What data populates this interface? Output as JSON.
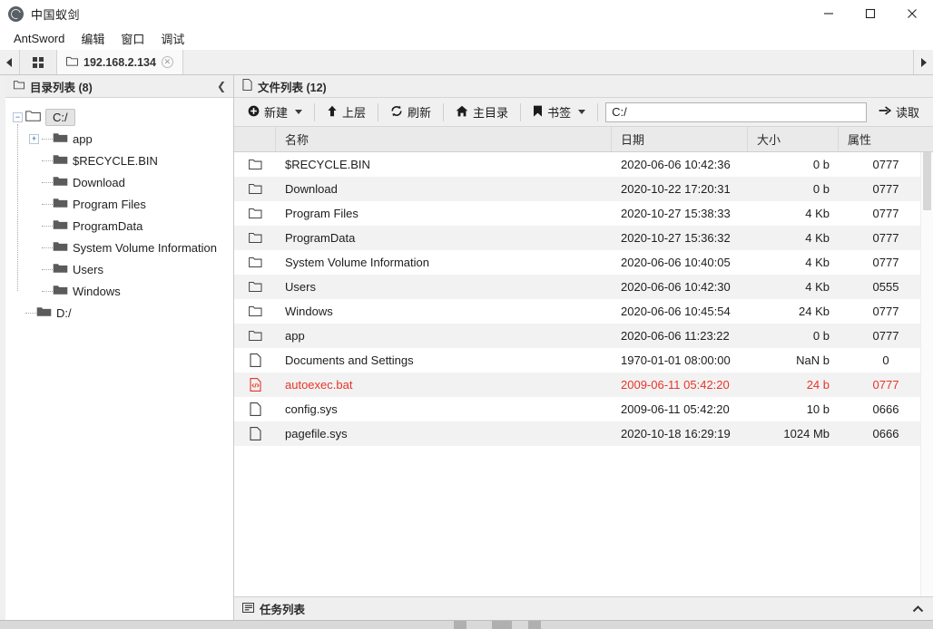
{
  "window": {
    "title": "中国蚁剑",
    "icon": "antsword-logo-icon",
    "minimize": "—",
    "maximize": "□",
    "close": "✕"
  },
  "menubar": {
    "items": [
      {
        "label": "AntSword"
      },
      {
        "label": "编辑"
      },
      {
        "label": "窗口"
      },
      {
        "label": "调试"
      }
    ]
  },
  "tabbar": {
    "scroll_left": "◀",
    "scroll_right": "▶",
    "home_tab": "grid-icon",
    "tabs": [
      {
        "label": "192.168.2.134",
        "close": "✕",
        "icon": "folder-icon"
      }
    ]
  },
  "sidebar": {
    "header": {
      "title": "目录列表 (8)",
      "icon": "folder-outline-icon",
      "collapse": "❮"
    },
    "tree": {
      "root": {
        "label": "C:/",
        "expander": "−",
        "selected": true
      },
      "children": [
        {
          "label": "app",
          "expander": "+"
        },
        {
          "label": "$RECYCLE.BIN",
          "expander": ""
        },
        {
          "label": "Download",
          "expander": ""
        },
        {
          "label": "Program Files",
          "expander": ""
        },
        {
          "label": "ProgramData",
          "expander": ""
        },
        {
          "label": "System Volume Information",
          "expander": ""
        },
        {
          "label": "Users",
          "expander": ""
        },
        {
          "label": "Windows",
          "expander": ""
        }
      ],
      "second_root": {
        "label": "D:/",
        "expander": ""
      }
    }
  },
  "filepanel": {
    "header": {
      "title": "文件列表 (12)",
      "icon": "file-outline-icon"
    },
    "toolbar": {
      "new_label": "新建",
      "new_icon": "plus-circle-icon",
      "up_label": "上层",
      "up_icon": "arrow-up-icon",
      "refresh_label": "刷新",
      "refresh_icon": "refresh-icon",
      "home_label": "主目录",
      "home_icon": "home-icon",
      "bookmark_label": "书签",
      "bookmark_icon": "bookmark-icon",
      "read_label": "读取",
      "read_icon": "arrow-right-icon"
    },
    "path": {
      "value": "C:/",
      "placeholder": "C:/"
    },
    "columns": {
      "icon": "",
      "name": "名称",
      "date": "日期",
      "size": "大小",
      "attr": "属性"
    },
    "rows": [
      {
        "icon": "folder-icon",
        "name": "$RECYCLE.BIN",
        "date": "2020-06-06 10:42:36",
        "size": "0 b",
        "attr": "0777",
        "danger": false
      },
      {
        "icon": "folder-icon",
        "name": "Download",
        "date": "2020-10-22 17:20:31",
        "size": "0 b",
        "attr": "0777",
        "danger": false
      },
      {
        "icon": "folder-icon",
        "name": "Program Files",
        "date": "2020-10-27 15:38:33",
        "size": "4 Kb",
        "attr": "0777",
        "danger": false
      },
      {
        "icon": "folder-icon",
        "name": "ProgramData",
        "date": "2020-10-27 15:36:32",
        "size": "4 Kb",
        "attr": "0777",
        "danger": false
      },
      {
        "icon": "folder-icon",
        "name": "System Volume Information",
        "date": "2020-06-06 10:40:05",
        "size": "4 Kb",
        "attr": "0777",
        "danger": false
      },
      {
        "icon": "folder-icon",
        "name": "Users",
        "date": "2020-06-06 10:42:30",
        "size": "4 Kb",
        "attr": "0555",
        "danger": false
      },
      {
        "icon": "folder-icon",
        "name": "Windows",
        "date": "2020-06-06 10:45:54",
        "size": "24 Kb",
        "attr": "0777",
        "danger": false
      },
      {
        "icon": "folder-icon",
        "name": "app",
        "date": "2020-06-06 11:23:22",
        "size": "0 b",
        "attr": "0777",
        "danger": false
      },
      {
        "icon": "file-icon",
        "name": "Documents and Settings",
        "date": "1970-01-01 08:00:00",
        "size": "NaN b",
        "attr": "0",
        "danger": false
      },
      {
        "icon": "file-code-icon",
        "name": "autoexec.bat",
        "date": "2009-06-11 05:42:20",
        "size": "24 b",
        "attr": "0777",
        "danger": true
      },
      {
        "icon": "file-icon",
        "name": "config.sys",
        "date": "2009-06-11 05:42:20",
        "size": "10 b",
        "attr": "0666",
        "danger": false
      },
      {
        "icon": "file-icon",
        "name": "pagefile.sys",
        "date": "2020-10-18 16:29:19",
        "size": "1024 Mb",
        "attr": "0666",
        "danger": false
      }
    ]
  },
  "taskbar": {
    "label": "任务列表",
    "icon": "list-icon",
    "chevron": "⌃"
  },
  "colors": {
    "danger": "#e8342a",
    "chrome": "#f0f0f0",
    "row_alt": "#f2f2f2",
    "header": "#eaeaea"
  }
}
